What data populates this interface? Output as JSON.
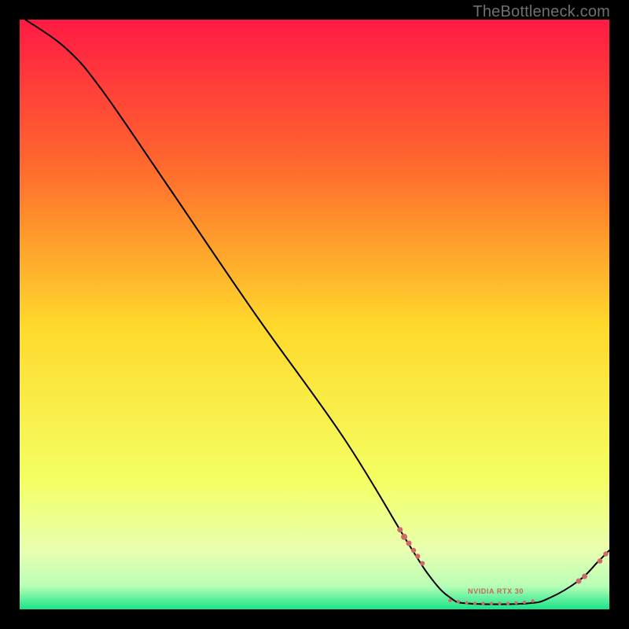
{
  "attribution": "TheBottleneck.com",
  "colors": {
    "gradient_top": "#ff1a44",
    "gradient_upper_mid": "#ff6a2d",
    "gradient_mid": "#ffd92b",
    "gradient_lower_mid": "#f4ff62",
    "gradient_bottom_band_top": "#e8ffb0",
    "gradient_bottom": "#19e38a",
    "curve": "#000000",
    "marker": "#cf6a6a",
    "background": "#000000"
  },
  "series_label": "NVIDIA RTX 30",
  "chart_data": {
    "type": "line",
    "title": "",
    "xlabel": "",
    "ylabel": "",
    "xlim": [
      0,
      100
    ],
    "ylim": [
      0,
      100
    ],
    "curve": [
      {
        "x": 1,
        "y": 100
      },
      {
        "x": 8,
        "y": 95
      },
      {
        "x": 14,
        "y": 88
      },
      {
        "x": 25,
        "y": 72
      },
      {
        "x": 40,
        "y": 50
      },
      {
        "x": 55,
        "y": 29
      },
      {
        "x": 66,
        "y": 11
      },
      {
        "x": 70,
        "y": 5
      },
      {
        "x": 73,
        "y": 2
      },
      {
        "x": 76,
        "y": 1
      },
      {
        "x": 86,
        "y": 1
      },
      {
        "x": 90,
        "y": 2
      },
      {
        "x": 95,
        "y": 5
      },
      {
        "x": 98,
        "y": 8
      },
      {
        "x": 100,
        "y": 10
      }
    ],
    "markers": [
      {
        "x": 64.5,
        "y": 13.5,
        "r": 3.5
      },
      {
        "x": 65.2,
        "y": 12.3,
        "r": 4.0
      },
      {
        "x": 66.0,
        "y": 11.2,
        "r": 3.5
      },
      {
        "x": 66.8,
        "y": 10.0,
        "r": 3.2
      },
      {
        "x": 67.5,
        "y": 9.0,
        "r": 3.2
      },
      {
        "x": 68.3,
        "y": 7.8,
        "r": 3.0
      },
      {
        "x": 73.0,
        "y": 1.5,
        "r": 2.2
      },
      {
        "x": 74.4,
        "y": 1.3,
        "r": 2.2
      },
      {
        "x": 75.8,
        "y": 1.1,
        "r": 2.2
      },
      {
        "x": 77.2,
        "y": 1.0,
        "r": 2.2
      },
      {
        "x": 78.6,
        "y": 1.0,
        "r": 2.2
      },
      {
        "x": 80.0,
        "y": 1.0,
        "r": 2.2
      },
      {
        "x": 81.4,
        "y": 1.0,
        "r": 2.2
      },
      {
        "x": 82.8,
        "y": 1.0,
        "r": 2.2
      },
      {
        "x": 84.2,
        "y": 1.1,
        "r": 2.2
      },
      {
        "x": 85.6,
        "y": 1.2,
        "r": 2.2
      },
      {
        "x": 87.0,
        "y": 1.4,
        "r": 2.2
      },
      {
        "x": 94.8,
        "y": 4.8,
        "r": 3.5
      },
      {
        "x": 95.8,
        "y": 5.6,
        "r": 3.5
      },
      {
        "x": 98.4,
        "y": 8.2,
        "r": 3.3
      },
      {
        "x": 99.4,
        "y": 9.4,
        "r": 3.2
      }
    ],
    "label_position": {
      "x": 80,
      "y": 3
    }
  }
}
